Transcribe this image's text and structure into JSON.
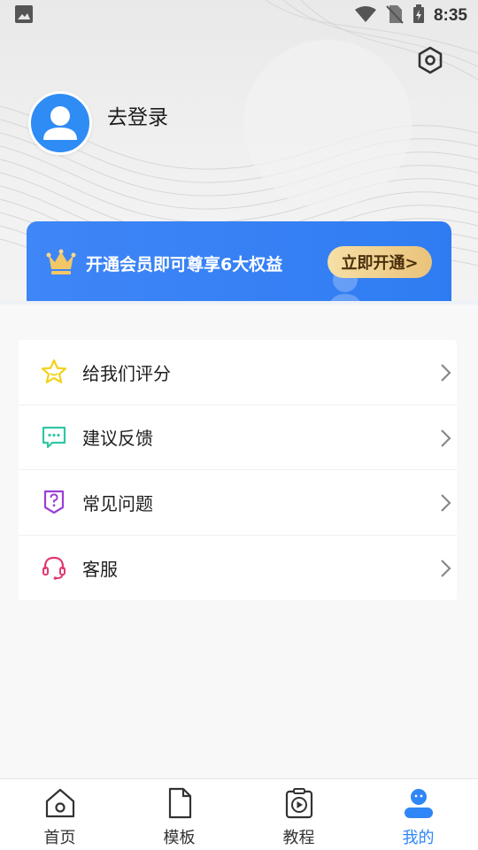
{
  "status_bar": {
    "time": "8:35"
  },
  "profile": {
    "login_text": "去登录"
  },
  "vip_banner": {
    "text": "开通会员即可尊享6大权益",
    "cta_label": "立即开通>"
  },
  "menu": {
    "items": [
      {
        "label": "给我们评分",
        "icon": "star-icon",
        "color": "#f2d21b"
      },
      {
        "label": "建议反馈",
        "icon": "feedback-icon",
        "color": "#2fc7a5"
      },
      {
        "label": "常见问题",
        "icon": "question-icon",
        "color": "#9a3fd6"
      },
      {
        "label": "客服",
        "icon": "headset-icon",
        "color": "#e0396f"
      }
    ]
  },
  "tabs": [
    {
      "label": "首页",
      "icon": "home-icon",
      "active": false
    },
    {
      "label": "模板",
      "icon": "template-icon",
      "active": false
    },
    {
      "label": "教程",
      "icon": "tutorial-icon",
      "active": false
    },
    {
      "label": "我的",
      "icon": "profile-icon",
      "active": true
    }
  ],
  "colors": {
    "accent": "#2f86f6",
    "banner": "#3f86f7",
    "cta": "#f0d28f"
  }
}
